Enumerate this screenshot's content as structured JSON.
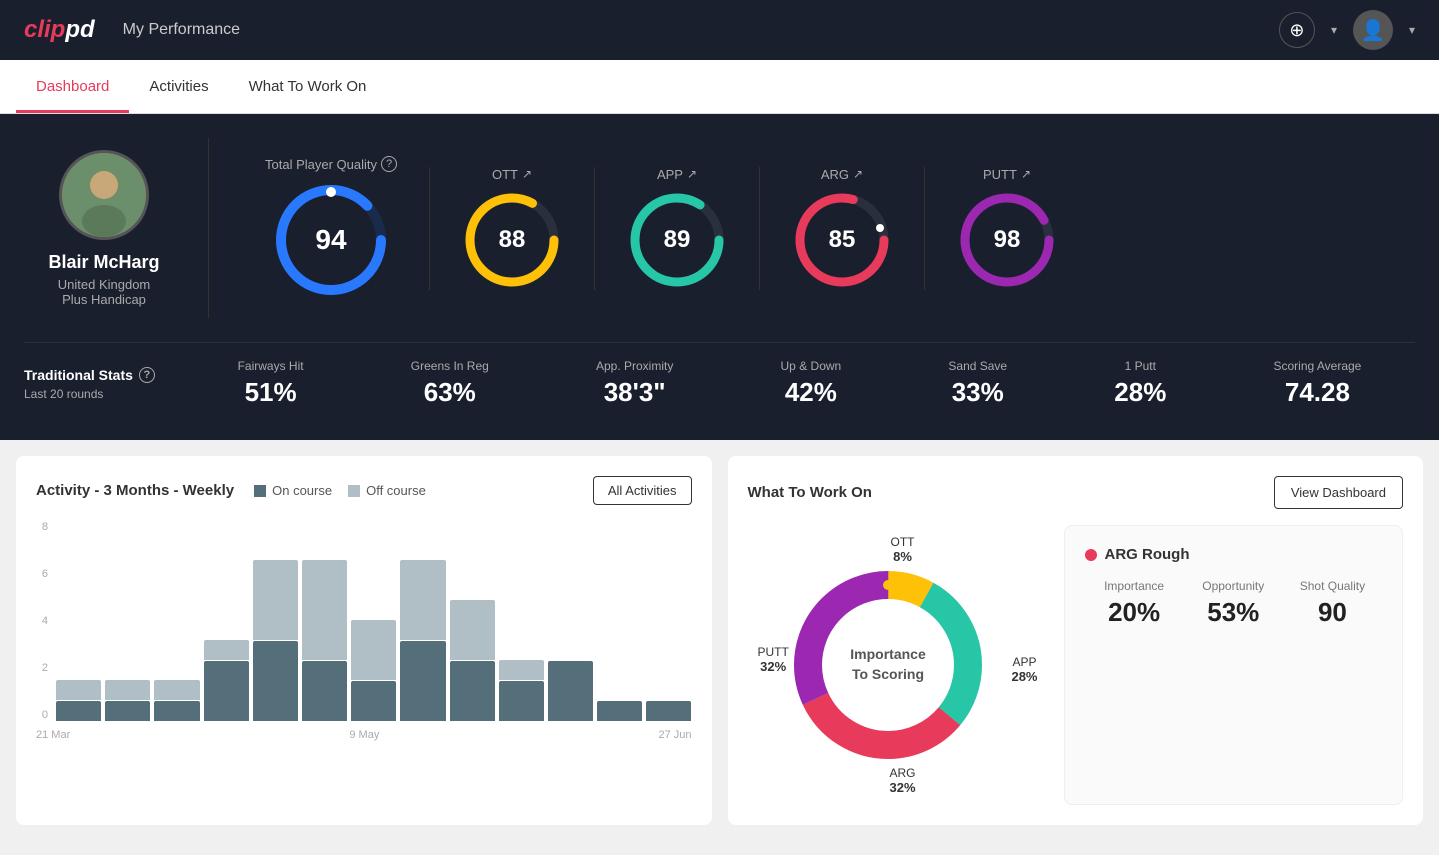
{
  "header": {
    "logo": "clippd",
    "title": "My Performance",
    "add_btn": "+",
    "avatar_label": "user avatar"
  },
  "tabs": [
    {
      "id": "dashboard",
      "label": "Dashboard",
      "active": true
    },
    {
      "id": "activities",
      "label": "Activities",
      "active": false
    },
    {
      "id": "what-to-work-on",
      "label": "What To Work On",
      "active": false
    }
  ],
  "player": {
    "name": "Blair McHarg",
    "country": "United Kingdom",
    "handicap": "Plus Handicap"
  },
  "scores": {
    "total": {
      "label": "Total Player Quality",
      "value": "94",
      "color": "#2979ff"
    },
    "ott": {
      "label": "OTT",
      "value": "88",
      "color": "#ffc107"
    },
    "app": {
      "label": "APP",
      "value": "89",
      "color": "#26c6a6"
    },
    "arg": {
      "label": "ARG",
      "value": "85",
      "color": "#e83a5a"
    },
    "putt": {
      "label": "PUTT",
      "value": "98",
      "color": "#9c27b0"
    }
  },
  "traditional_stats": {
    "title": "Traditional Stats",
    "subtitle": "Last 20 rounds",
    "items": [
      {
        "name": "Fairways Hit",
        "value": "51%"
      },
      {
        "name": "Greens In Reg",
        "value": "63%"
      },
      {
        "name": "App. Proximity",
        "value": "38'3\""
      },
      {
        "name": "Up & Down",
        "value": "42%"
      },
      {
        "name": "Sand Save",
        "value": "33%"
      },
      {
        "name": "1 Putt",
        "value": "28%"
      },
      {
        "name": "Scoring Average",
        "value": "74.28"
      }
    ]
  },
  "activity_chart": {
    "title": "Activity - 3 Months - Weekly",
    "legend": {
      "on_course": "On course",
      "off_course": "Off course"
    },
    "all_btn": "All Activities",
    "y_labels": [
      "8",
      "6",
      "4",
      "2",
      "0"
    ],
    "x_labels": [
      "21 Mar",
      "9 May",
      "27 Jun"
    ],
    "bars": [
      {
        "on": 1,
        "off": 1
      },
      {
        "on": 1,
        "off": 1
      },
      {
        "on": 1,
        "off": 1
      },
      {
        "on": 3,
        "off": 1
      },
      {
        "on": 4,
        "off": 4
      },
      {
        "on": 3,
        "off": 5
      },
      {
        "on": 2,
        "off": 3
      },
      {
        "on": 4,
        "off": 4
      },
      {
        "on": 3,
        "off": 3
      },
      {
        "on": 2,
        "off": 1
      },
      {
        "on": 3,
        "off": 0
      },
      {
        "on": 1,
        "off": 0
      },
      {
        "on": 1,
        "off": 0
      }
    ],
    "max": 9
  },
  "wtwo": {
    "title": "What To Work On",
    "view_btn": "View Dashboard",
    "donut": {
      "center_line1": "Importance",
      "center_line2": "To Scoring",
      "segments": [
        {
          "label": "OTT",
          "pct": "8%",
          "color": "#ffc107"
        },
        {
          "label": "APP",
          "pct": "28%",
          "color": "#26c6a6"
        },
        {
          "label": "ARG",
          "pct": "32%",
          "color": "#e83a5a"
        },
        {
          "label": "PUTT",
          "pct": "32%",
          "color": "#9c27b0"
        }
      ]
    },
    "detail": {
      "title": "ARG Rough",
      "dot_color": "#e83a5a",
      "metrics": [
        {
          "label": "Importance",
          "value": "20%"
        },
        {
          "label": "Opportunity",
          "value": "53%"
        },
        {
          "label": "Shot Quality",
          "value": "90"
        }
      ]
    }
  }
}
